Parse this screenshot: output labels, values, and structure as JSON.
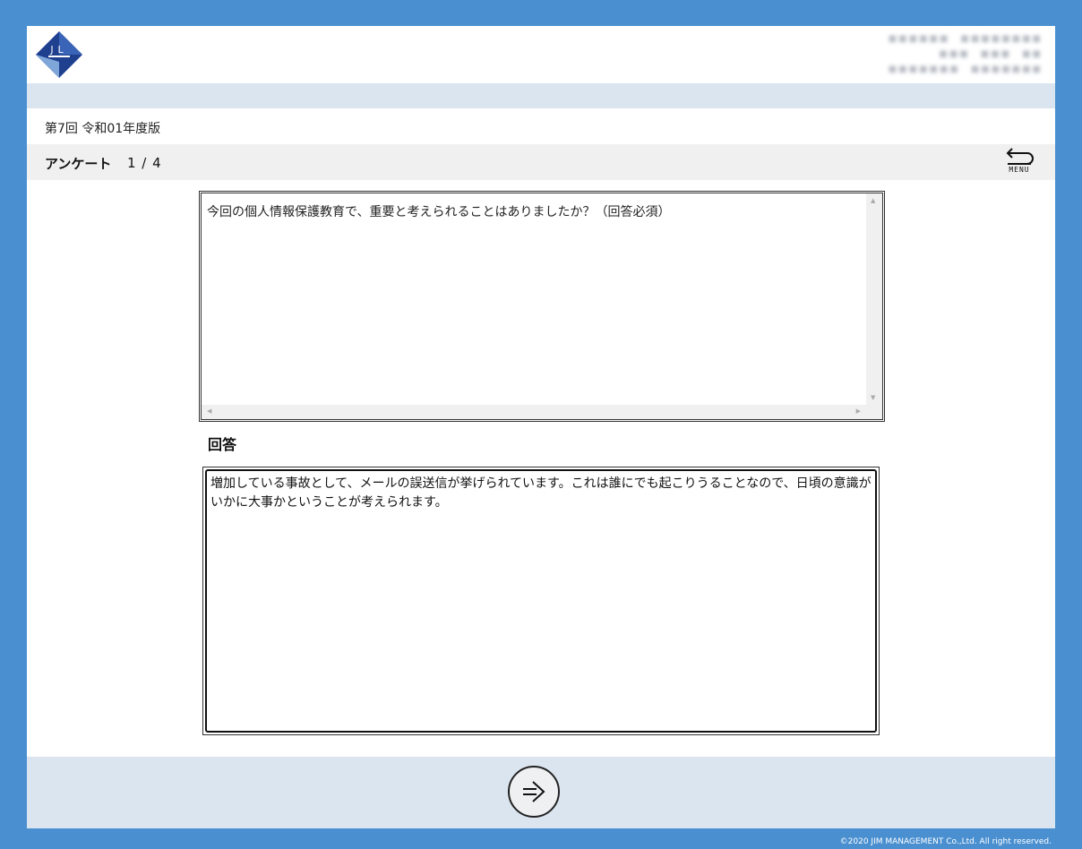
{
  "course": {
    "title": "第7回 令和01年度版"
  },
  "survey": {
    "label": "アンケート",
    "progress": "1 / 4",
    "menu_label": "MENU"
  },
  "question": {
    "text": "今回の個人情報保護教育で、重要と考えられることはありましたか？（回答必須）"
  },
  "answer": {
    "heading": "回答",
    "value": "増加している事故として、メールの誤送信が挙げられています。これは誰にでも起こりうることなので、日頃の意識がいかに大事かということが考えられます。"
  },
  "footer": {
    "copyright": "©2020 JIM MANAGEMENT Co.,Ltd. All right reserved."
  },
  "logo": {
    "text": "JL"
  },
  "colors": {
    "frame": "#4a90d0",
    "strip": "#dbe5ef",
    "bar": "#f0f0f0"
  }
}
